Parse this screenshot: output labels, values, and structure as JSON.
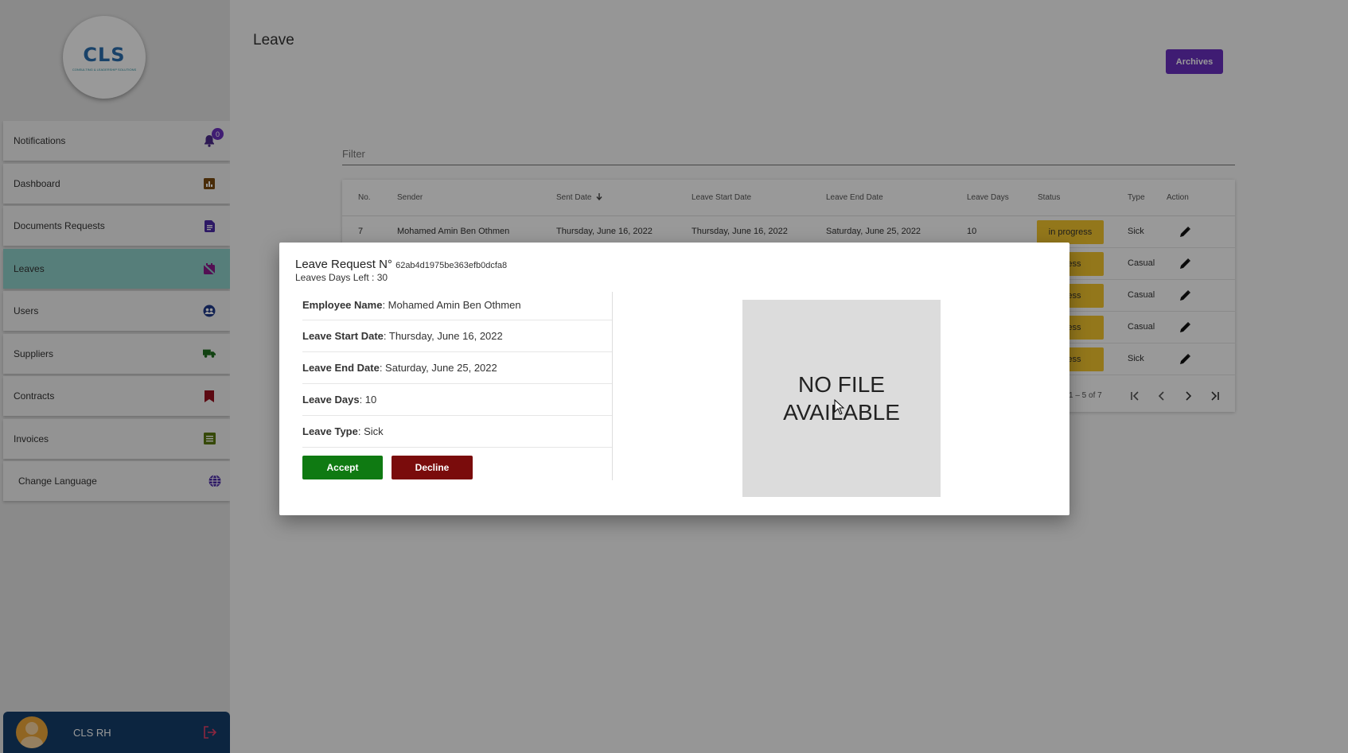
{
  "logo": {
    "text": "CLS",
    "subtext": "CONSULTING & LEADERSHIP SOLUTIONS"
  },
  "sidebar": {
    "items": [
      {
        "label": "Notifications",
        "icon": "bell-icon",
        "badge": "0"
      },
      {
        "label": "Dashboard",
        "icon": "chart-icon"
      },
      {
        "label": "Documents Requests",
        "icon": "document-icon"
      },
      {
        "label": "Leaves",
        "icon": "calendar-off-icon",
        "active": true
      },
      {
        "label": "Users",
        "icon": "users-globe-icon"
      },
      {
        "label": "Suppliers",
        "icon": "truck-icon"
      },
      {
        "label": "Contracts",
        "icon": "bookmark-icon"
      },
      {
        "label": "Invoices",
        "icon": "list-icon"
      },
      {
        "label": "Change Language",
        "icon": "globe-icon"
      }
    ]
  },
  "user": {
    "name": "CLS RH"
  },
  "page": {
    "title": "Leave",
    "archives_label": "Archives",
    "filter_placeholder": "Filter"
  },
  "table": {
    "headers": {
      "no": "No.",
      "sender": "Sender",
      "sent_date": "Sent Date",
      "start": "Leave Start Date",
      "end": "Leave End Date",
      "days": "Leave Days",
      "status": "Status",
      "type": "Type",
      "action": "Action"
    },
    "rows": [
      {
        "no": "7",
        "sender": "Mohamed Amin Ben Othmen",
        "sent_date": "Thursday, June 16, 2022",
        "start": "Thursday, June 16, 2022",
        "end": "Saturday, June 25, 2022",
        "days": "10",
        "status": "in progress",
        "type": "Sick"
      },
      {
        "no": "",
        "sender": "",
        "sent_date": "",
        "start": "",
        "end": "",
        "days": "",
        "status": "gress",
        "type": "Casual"
      },
      {
        "no": "",
        "sender": "",
        "sent_date": "",
        "start": "",
        "end": "",
        "days": "",
        "status": "gress",
        "type": "Casual"
      },
      {
        "no": "",
        "sender": "",
        "sent_date": "",
        "start": "",
        "end": "",
        "days": "",
        "status": "gress",
        "type": "Casual"
      },
      {
        "no": "",
        "sender": "",
        "sent_date": "",
        "start": "",
        "end": "",
        "days": "",
        "status": "gress",
        "type": "Sick"
      }
    ],
    "paginator": {
      "range": "1 – 5 of 7"
    },
    "colors": {
      "status_bg": "#f5c62d",
      "accent": "#6a2fc0"
    }
  },
  "dialog": {
    "title_prefix": "Leave Request N°",
    "request_id": "62ab4d1975be363efb0dcfa8",
    "days_left": "Leaves Days Left : 30",
    "employee_label": "Employee Name",
    "employee_value": " : Mohamed Amin Ben Othmen",
    "start_label": "Leave Start Date",
    "start_value": " : Thursday, June 16, 2022",
    "end_label": "Leave End Date",
    "end_value": " : Saturday, June 25, 2022",
    "days_label": "Leave Days",
    "days_value": " : 10",
    "type_label": "Leave Type",
    "type_value": " : Sick",
    "accept_label": "Accept",
    "decline_label": "Decline",
    "no_file_text": "NO FILE AVAILABLE",
    "colors": {
      "accept": "#0f7a12",
      "decline": "#7a0c0c"
    }
  }
}
